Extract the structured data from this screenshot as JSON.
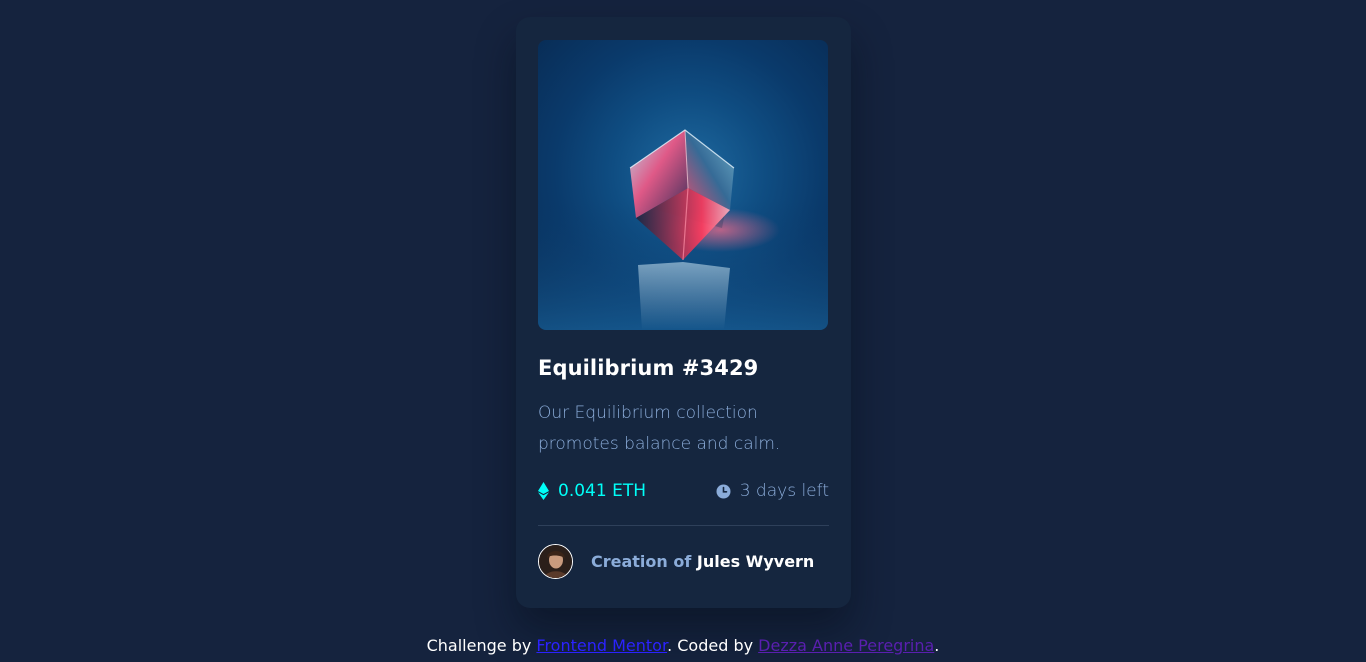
{
  "card": {
    "title": "Equilibrium #3429",
    "description": "Our Equilibrium collection promotes balance and calm.",
    "price": "0.041 ETH",
    "time_left": "3 days left",
    "creator_prefix": "Creation of",
    "creator_name": "Jules Wyvern",
    "image_icon": "crystal-cube-artwork",
    "price_icon": "ethereum-icon",
    "time_icon": "clock-icon"
  },
  "footer": {
    "prefix": "Challenge by",
    "challenge_link": "Frontend Mentor",
    "middle": ". Coded by",
    "author_link": "Dezza Anne Peregrina",
    "suffix": "."
  },
  "colors": {
    "background": "#15233e",
    "card": "#15263f",
    "cyan": "#00fff8",
    "soft_blue": "#8bacd9",
    "white": "#ffffff"
  }
}
